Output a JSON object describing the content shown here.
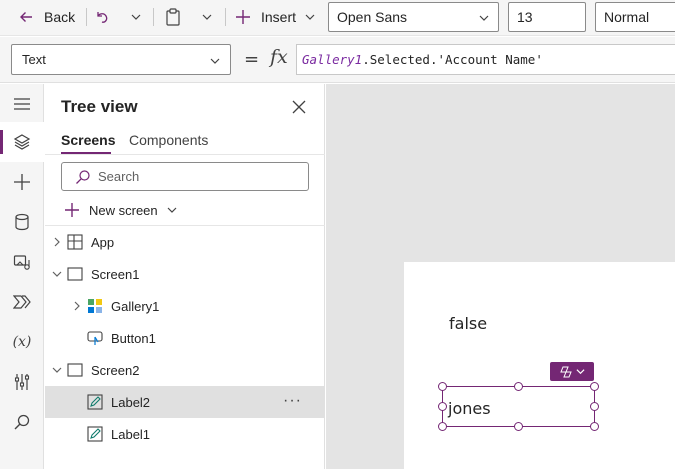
{
  "toolbar": {
    "back_label": "Back",
    "insert_label": "Insert",
    "font_family": "Open Sans",
    "font_size": "13",
    "font_weight": "Normal"
  },
  "formula_bar": {
    "property": "Text",
    "equals": "=",
    "fx": "fx",
    "formula_control": "Gallery1",
    "formula_rest": ".Selected.",
    "formula_string": "'Account Name'"
  },
  "tree_view": {
    "title": "Tree view",
    "tabs": [
      {
        "label": "Screens",
        "active": true
      },
      {
        "label": "Components",
        "active": false
      }
    ],
    "search_placeholder": "Search",
    "new_screen_label": "New screen",
    "nodes": [
      {
        "label": "App",
        "icon": "app-icon"
      },
      {
        "label": "Screen1",
        "icon": "screen-icon"
      },
      {
        "label": "Gallery1",
        "icon": "gallery-icon"
      },
      {
        "label": "Button1",
        "icon": "button-icon"
      },
      {
        "label": "Screen2",
        "icon": "screen-icon"
      },
      {
        "label": "Label2",
        "icon": "label-icon",
        "selected": true
      },
      {
        "label": "Label1",
        "icon": "label-icon"
      }
    ],
    "more_label": "···"
  },
  "canvas": {
    "label_false_text": "false",
    "selected_label_text": "jones"
  },
  "colors": {
    "accent": "#742774",
    "selected_row": "#e0e0e0",
    "canvas_bg": "#e4e4e4"
  },
  "rail_icons": [
    "hamburger-icon",
    "layers-icon",
    "plus-icon",
    "data-icon",
    "media-icon",
    "power-automate-icon",
    "variables-icon",
    "advanced-tools-icon",
    "search-icon"
  ]
}
